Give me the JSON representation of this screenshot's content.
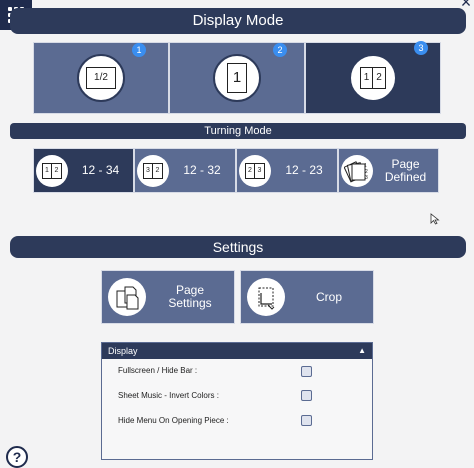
{
  "header": {
    "title": "Display Mode"
  },
  "display_modes": [
    {
      "badge": "1",
      "icon_text": "1/2",
      "icon": "half-page-icon",
      "selected": false
    },
    {
      "badge": "2",
      "icon_text": "1",
      "icon": "single-page-icon",
      "selected": false
    },
    {
      "badge": "3",
      "icon_text_left": "1",
      "icon_text_right": "2",
      "icon": "two-page-icon",
      "selected": true
    }
  ],
  "turning_mode": {
    "title": "Turning Mode",
    "options": [
      {
        "label": "12 - 34",
        "icon_left": "1",
        "icon_right": "2",
        "selected": true
      },
      {
        "label": "12 - 32",
        "icon_left": "3",
        "icon_right": "2",
        "selected": false
      },
      {
        "label": "12 - 23",
        "icon_left": "2",
        "icon_right": "3",
        "selected": false
      },
      {
        "label_line1": "Page",
        "label_line2": "Defined",
        "selected": false
      }
    ]
  },
  "settings": {
    "title": "Settings",
    "page_settings_line1": "Page",
    "page_settings_line2": "Settings",
    "crop_label": "Crop"
  },
  "display_panel": {
    "title": "Display",
    "options": [
      {
        "label": "Fullscreen / Hide Bar :",
        "checked": false
      },
      {
        "label": "Sheet Music - Invert Colors :",
        "checked": false
      },
      {
        "label": "Hide Menu On Opening Piece :",
        "checked": false
      }
    ]
  },
  "help_label": "?",
  "colors": {
    "dark": "#2d3a5a",
    "mid": "#5b6b92",
    "badge": "#3a8ef0"
  }
}
